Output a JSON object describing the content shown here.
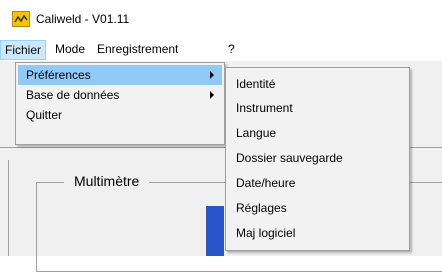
{
  "window": {
    "title": "Caliweld - V01.11",
    "icon": "app-icon"
  },
  "menubar": {
    "items": [
      {
        "label": "Fichier"
      },
      {
        "label": "Mode"
      },
      {
        "label": "Enregistrement"
      },
      {
        "label": "?"
      }
    ]
  },
  "file_menu": {
    "items": [
      {
        "label": "Préférences"
      },
      {
        "label": "Base de données"
      },
      {
        "label": "Quitter"
      }
    ]
  },
  "preferences_submenu": {
    "items": [
      {
        "label": "Identité"
      },
      {
        "label": "Instrument"
      },
      {
        "label": "Langue"
      },
      {
        "label": "Dossier sauvegarde"
      },
      {
        "label": "Date/heure"
      },
      {
        "label": "Réglages"
      },
      {
        "label": "Maj logiciel"
      }
    ]
  },
  "main": {
    "groupbox_title": "Multimètre"
  },
  "colors": {
    "accent": "#2a55c8",
    "menu_highlight": "#91c9f7",
    "menubar_active": "#cce8ff"
  }
}
